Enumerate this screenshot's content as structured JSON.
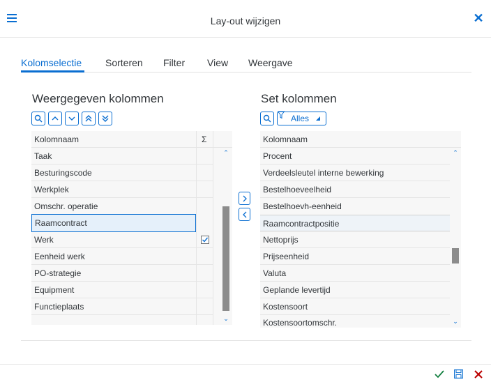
{
  "header": {
    "title": "Lay-out wijzigen"
  },
  "tabs": [
    {
      "label": "Kolomselectie",
      "active": true
    },
    {
      "label": "Sorteren"
    },
    {
      "label": "Filter"
    },
    {
      "label": "View"
    },
    {
      "label": "Weergave"
    }
  ],
  "left": {
    "title": "Weergegeven kolommen",
    "col_name": "Kolomnaam",
    "col_sum": "Σ",
    "rows": [
      {
        "label": "Taak"
      },
      {
        "label": "Besturingscode"
      },
      {
        "label": "Werkplek"
      },
      {
        "label": "Omschr. operatie"
      },
      {
        "label": "Raamcontract",
        "selected": true
      },
      {
        "label": "Werk",
        "sum_checked": true
      },
      {
        "label": "Eenheid werk"
      },
      {
        "label": "PO-strategie"
      },
      {
        "label": "Equipment"
      },
      {
        "label": "Functieplaats"
      }
    ]
  },
  "right": {
    "title": "Set kolommen",
    "filter_label": "Alles",
    "col_name": "Kolomnaam",
    "rows": [
      {
        "label": "Procent"
      },
      {
        "label": "Verdeelsleutel interne bewerking"
      },
      {
        "label": "Bestelhoeveelheid"
      },
      {
        "label": "Bestelhoevh-eenheid"
      },
      {
        "label": "Raamcontractpositie",
        "highlighted": true
      },
      {
        "label": "Nettoprijs"
      },
      {
        "label": "Prijseenheid"
      },
      {
        "label": "Valuta"
      },
      {
        "label": "Geplande levertijd"
      },
      {
        "label": "Kostensoort"
      },
      {
        "label": "Kostensoortomschr."
      }
    ]
  },
  "icons": {
    "menu": "hamburger-icon",
    "close": "close-icon",
    "search": "search-icon",
    "up": "chevron-up-icon",
    "down": "chevron-down-icon",
    "top": "double-chevron-up-icon",
    "bottom": "double-chevron-down-icon",
    "filter": "filter-icon",
    "ok": "checkmark-icon",
    "save": "save-icon",
    "cancel": "cancel-icon"
  },
  "colors": {
    "accent": "#0a6ed1",
    "ok": "#107e3e",
    "cancel": "#bb0000"
  }
}
